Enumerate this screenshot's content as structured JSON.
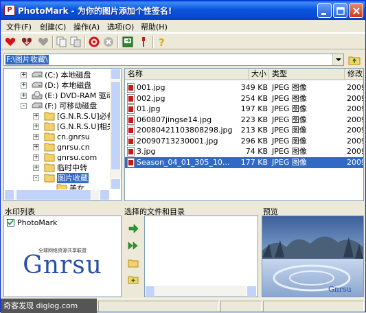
{
  "window": {
    "app_icon_letter": "P",
    "title": "PhotoMark - 为你的图片添加个性签名!"
  },
  "menu": [
    {
      "label": "文件(F)"
    },
    {
      "label": "创建(C)"
    },
    {
      "label": "操作(A)"
    },
    {
      "label": "选项(O)"
    },
    {
      "label": "帮助(H)"
    }
  ],
  "toolbar": {
    "icons": [
      "heart-icon",
      "heart-down-icon",
      "heart-gray-icon",
      "copy-doc-icon",
      "move-doc-icon",
      "refresh-icon",
      "stop-icon",
      "monitor-icon",
      "wrench-icon",
      "help-icon"
    ]
  },
  "path": {
    "value": "F:\\图片收藏\\"
  },
  "tree": {
    "items": [
      {
        "label": "(C:) 本地磁盘",
        "icon": "drive-icon",
        "expander": "+"
      },
      {
        "label": "(D:) 本地磁盘",
        "icon": "drive-icon",
        "expander": "+"
      },
      {
        "label": "(E:) DVD-RAM 驱动器",
        "icon": "dvd-drive-icon",
        "expander": "+"
      },
      {
        "label": "(F:) 可移动磁盘",
        "icon": "removable-drive-icon",
        "expander": "-"
      },
      {
        "label": "[G.N.R.S.U]必备工",
        "icon": "folder-icon",
        "expander": "+"
      },
      {
        "label": "[G.N.R.S.U]相关资",
        "icon": "folder-icon",
        "expander": "+"
      },
      {
        "label": "cn.gnrsu",
        "icon": "folder-icon",
        "expander": "+"
      },
      {
        "label": "gnrsu.cn",
        "icon": "folder-icon",
        "expander": "+"
      },
      {
        "label": "gnrsu.com",
        "icon": "folder-icon",
        "expander": "+"
      },
      {
        "label": "临时中转",
        "icon": "folder-icon",
        "expander": "+"
      },
      {
        "label": "图片收藏",
        "icon": "folder-open-icon",
        "expander": "-",
        "selected": true
      },
      {
        "label": "美女",
        "icon": "folder-icon",
        "expander": ""
      }
    ]
  },
  "file_list": {
    "columns": [
      "名称",
      "大小",
      "类型",
      "修改"
    ],
    "rows": [
      {
        "name": "001.jpg",
        "size": "349 KB",
        "type": "JPEG 图像",
        "modified": "2009"
      },
      {
        "name": "002.jpg",
        "size": "254 KB",
        "type": "JPEG 图像",
        "modified": "2009"
      },
      {
        "name": "01.jpg",
        "size": "197 KB",
        "type": "JPEG 图像",
        "modified": "2009"
      },
      {
        "name": "060807jingse14.jpg",
        "size": "223 KB",
        "type": "JPEG 图像",
        "modified": "2009"
      },
      {
        "name": "20080421103808298.jpg",
        "size": "213 KB",
        "type": "JPEG 图像",
        "modified": "2009"
      },
      {
        "name": "20090713230001.jpg",
        "size": "296 KB",
        "type": "JPEG 图像",
        "modified": "2009"
      },
      {
        "name": "3.jpg",
        "size": "74 KB",
        "type": "JPEG 图像",
        "modified": "2009"
      },
      {
        "name": "Season_04_01_305_10...",
        "size": "177 KB",
        "type": "JPEG 图像",
        "modified": "2009",
        "selected": true
      }
    ]
  },
  "panels": {
    "watermark_title": "水印列表",
    "selected_title": "选择的文件和目录",
    "preview_title": "预览",
    "watermark_item": "PhotoMark",
    "watermark_checked": true,
    "logo_tagline": "全球网络资源共享联盟",
    "logo_text": "Gnrsu",
    "preview_logo": "Gnrsu"
  },
  "overlay": {
    "site_watermark": "奇客发现 diglog.com"
  },
  "colors": {
    "titlebar": "#0a55e0",
    "selection": "#316ac5",
    "logo_blue": "#2a4fa8",
    "logo_red": "#d22",
    "logo_yellow": "#e5b100",
    "logo_green": "#2a9a2a"
  }
}
